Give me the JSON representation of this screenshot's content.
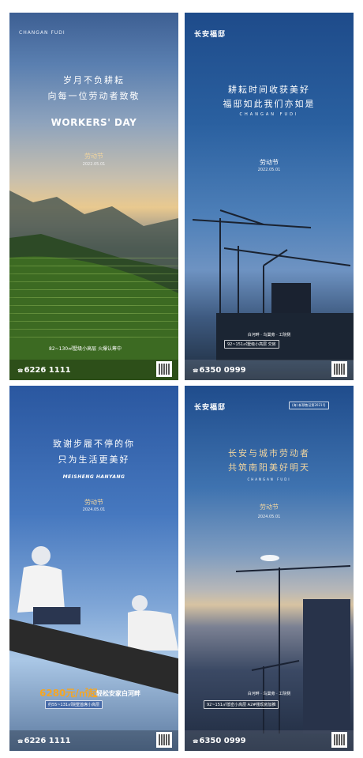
{
  "posters": [
    {
      "brand": "CHANGAN FUDI",
      "headline_line1": "岁月不负耕耘",
      "headline_line2": "向每一位劳动者致敬",
      "sub_en": "WORKERS' DAY",
      "festival": "劳动节",
      "date": "2022.05.01",
      "promo": "82~130㎡墅级小高层 火爆认筹中",
      "phone": "6226 1111"
    },
    {
      "brand": "长安福邸",
      "headline_line1": "耕耘时间收获美好",
      "headline_line2": "福邸如此我们亦如是",
      "sub_en": "CHANGAN FUDI",
      "festival": "劳动节",
      "date": "2022.05.01",
      "location": "白河畔 · 鸟巢旁 · 工院侧",
      "promo_pill": "92~151㎡墅级小高层 交房",
      "phone": "6350 0999"
    },
    {
      "headline_line1": "致谢步履不停的你",
      "headline_line2": "只为生活更美好",
      "sub_en": "MEISHENG HANYANG",
      "festival": "劳动节",
      "date": "2024.05.01",
      "price": "6280元/㎡起",
      "price_tagline": "轻松安家白河畔",
      "promo_pill": "约55~131㎡院墅首席小高层",
      "phone": "6226 1111"
    },
    {
      "brand": "长安福邸",
      "badge": "(海) 新预售证第2021号",
      "headline_line1": "长安与城市劳动者",
      "headline_line2": "共筑南阳美好明天",
      "sub_en": "CHANGAN FUDI",
      "festival": "劳动节",
      "date": "2024.05.01",
      "location": "白河畔 · 鸟巢旁 · 工院侧",
      "promo_pill": "92~151㎡低密小高层 A2#楼现房加推",
      "phone": "6350 0999"
    }
  ],
  "colors": {
    "gold": "#f0d5a0",
    "price_orange": "#f5a623"
  }
}
